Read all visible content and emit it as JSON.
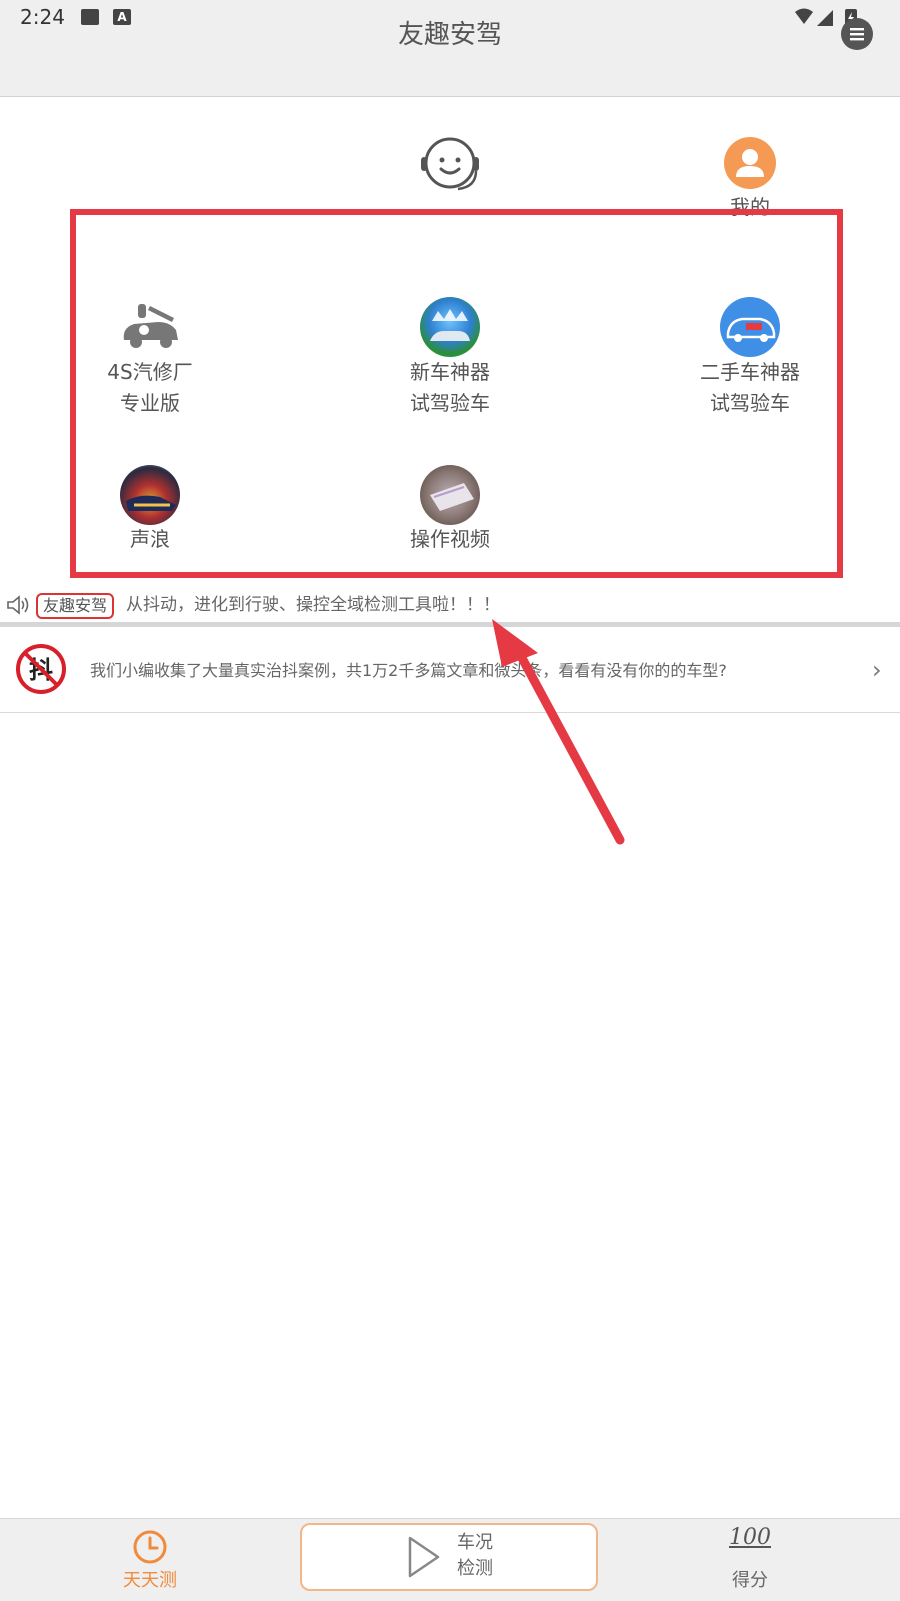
{
  "status": {
    "time": "2:24"
  },
  "header": {
    "title": "友趣安驾"
  },
  "top": {
    "profile_label": "我的"
  },
  "grid": [
    {
      "line1": "4S汽修厂",
      "line2": "专业版"
    },
    {
      "line1": "新车神器",
      "line2": "试驾验车"
    },
    {
      "line1": "二手车神器",
      "line2": "试驾验车"
    },
    {
      "line1": "声浪",
      "line2": ""
    },
    {
      "line1": "操作视频",
      "line2": ""
    }
  ],
  "announcement": {
    "tag": "友趣安驾",
    "text": "从抖动，进化到行驶、操控全域检测工具啦！！！"
  },
  "article": {
    "icon_char": "抖",
    "text": "我们小编收集了大量真实治抖案例，共1万2千多篇文章和微头条，看看有没有你的的车型?"
  },
  "nav": {
    "daily": "天天测",
    "check_line1": "车况",
    "check_line2": "检测",
    "score_icon": "100",
    "score": "得分"
  },
  "colors": {
    "accent": "#f08a3c",
    "highlight_frame": "#e53943",
    "arrow": "#e53943"
  },
  "icons": {
    "support": "headset-smile-icon",
    "profile": "user-avatar-icon",
    "repair": "car-repair-icon",
    "new_car": "new-car-icon",
    "used_car": "used-car-icon",
    "sound": "sound-wave-icon",
    "video": "video-tutorial-icon",
    "speaker": "speaker-icon",
    "daily": "clock-icon",
    "check": "play-icon",
    "chevron": "chevron-right-icon"
  }
}
